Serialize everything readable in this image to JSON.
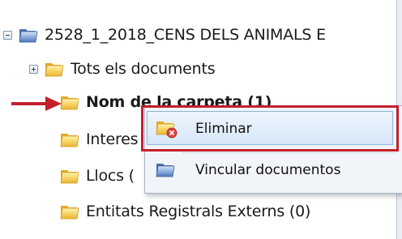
{
  "tree": {
    "root_label": "2528_1_2018_CENS DELS ANIMALS E",
    "items": [
      {
        "label": "Tots els documents"
      },
      {
        "label": "Nom de la carpeta (1)"
      },
      {
        "label": "Interes"
      },
      {
        "label": "Llocs ("
      },
      {
        "label": "Entitats Registrals Externs (0)"
      }
    ]
  },
  "context_menu": {
    "items": [
      {
        "label": "Eliminar",
        "icon": "folder-delete-icon"
      },
      {
        "label": "Vincular documentos",
        "icon": "folder-link-icon"
      }
    ]
  },
  "colors": {
    "annotation_red": "#c3202b",
    "folder_yellow": "#f4c94a",
    "folder_blue": "#6f93c9"
  }
}
